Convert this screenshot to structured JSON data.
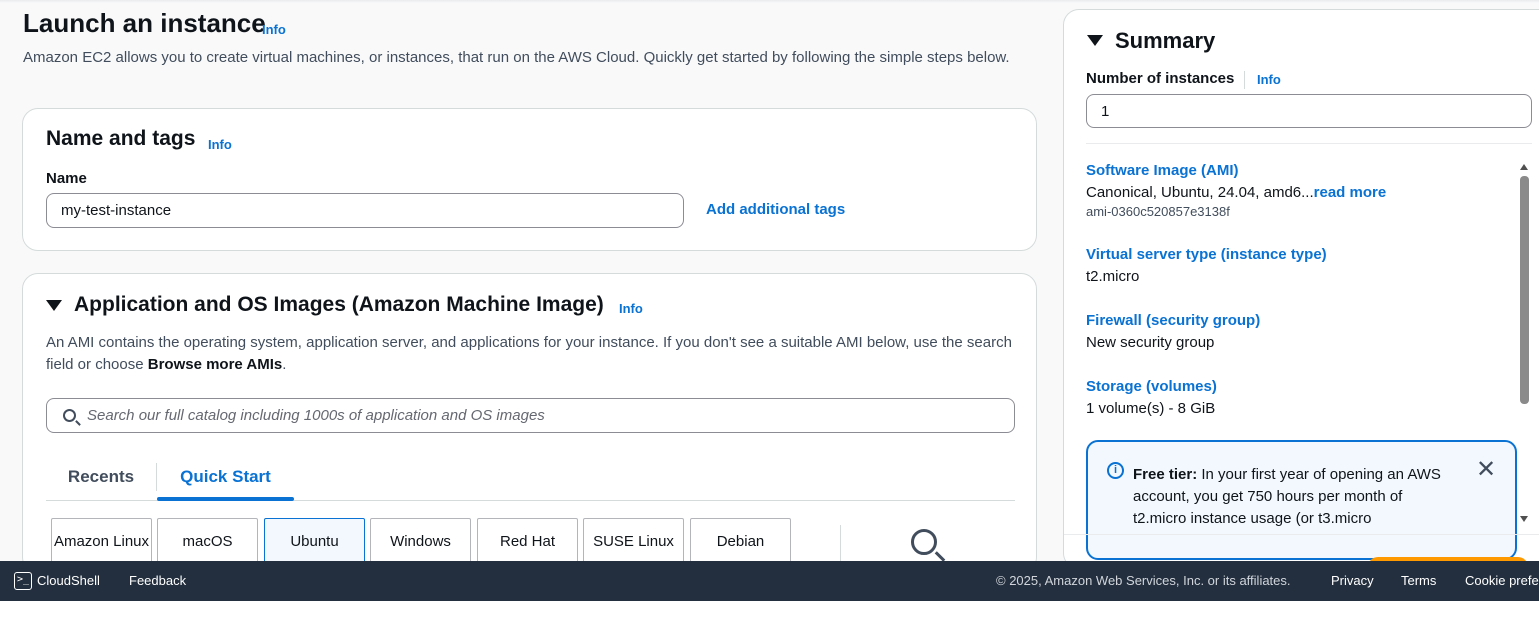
{
  "header": {
    "title": "Launch an instance",
    "info": "Info",
    "description": "Amazon EC2 allows you to create virtual machines, or instances, that run on the AWS Cloud. Quickly get started by following the simple steps below."
  },
  "name_tags": {
    "heading": "Name and tags",
    "info": "Info",
    "name_label": "Name",
    "name_value": "my-test-instance",
    "add_tags": "Add additional tags"
  },
  "ami": {
    "heading": "Application and OS Images (Amazon Machine Image)",
    "info": "Info",
    "description_pre": "An AMI contains the operating system, application server, and applications for your instance. If you don't see a suitable AMI below, use the search field or choose ",
    "description_bold": "Browse more AMIs",
    "description_post": ".",
    "search_placeholder": "Search our full catalog including 1000s of application and OS images",
    "tabs": [
      "Recents",
      "Quick Start"
    ],
    "os_tiles": [
      "Amazon Linux",
      "macOS",
      "Ubuntu",
      "Windows",
      "Red Hat",
      "SUSE Linux",
      "Debian"
    ],
    "selected_os": "Ubuntu"
  },
  "summary": {
    "title": "Summary",
    "count_label": "Number of instances",
    "count_info": "Info",
    "count_value": "1",
    "software_image_title": "Software Image (AMI)",
    "software_image_value": "Canonical, Ubuntu, 24.04, amd6...",
    "read_more": "read more",
    "ami_id": "ami-0360c520857e3138f",
    "instance_type_title": "Virtual server type (instance type)",
    "instance_type_value": "t2.micro",
    "firewall_title": "Firewall (security group)",
    "firewall_value": "New security group",
    "storage_title": "Storage (volumes)",
    "storage_value": "1 volume(s) - 8 GiB",
    "free_tier_bold": "Free tier:",
    "free_tier_text": " In your first year of opening an AWS account, you get 750 hours per month of t2.micro instance usage (or t3.micro"
  },
  "footer": {
    "cloudshell": "CloudShell",
    "feedback": "Feedback",
    "copyright": "© 2025, Amazon Web Services, Inc. or its affiliates.",
    "privacy": "Privacy",
    "terms": "Terms",
    "cookie": "Cookie prefe"
  },
  "icons": {
    "info": "info-circle-icon",
    "close": "close-icon",
    "search": "search-icon",
    "caret": "caret-down-icon",
    "cloudshell": "terminal-icon"
  },
  "colors": {
    "link": "#0972d3",
    "footer_bg": "#232f3e",
    "selected_tile_bg": "#f2f8fd"
  }
}
